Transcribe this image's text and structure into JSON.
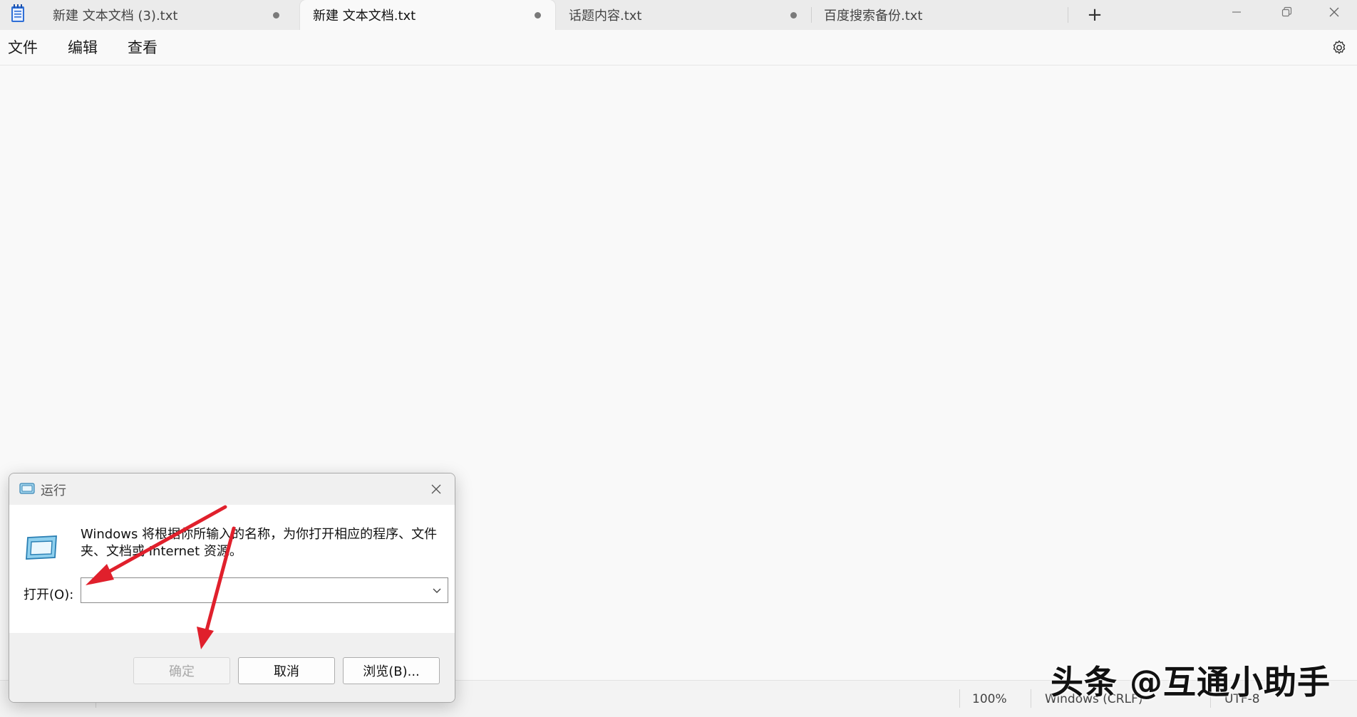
{
  "tabs": [
    {
      "label": "新建 文本文档 (3).txt",
      "modified": true,
      "active": false
    },
    {
      "label": "新建 文本文档.txt",
      "modified": true,
      "active": true
    },
    {
      "label": "话题内容.txt",
      "modified": true,
      "active": false
    },
    {
      "label": "百度搜索备份.txt",
      "modified": false,
      "active": false
    }
  ],
  "new_tab_label": "+",
  "menu": {
    "file": "文件",
    "edit": "编辑",
    "view": "查看"
  },
  "statusbar": {
    "position": "",
    "chars": "",
    "zoom": "100%",
    "line_ending": "Windows (CRLF)",
    "encoding": "UTF-8"
  },
  "watermark": "头条 @互通小助手",
  "run_dialog": {
    "title": "运行",
    "description": "Windows 将根据你所输入的名称，为你打开相应的程序、文件夹、文档或 Internet 资源。",
    "open_label": "打开(O):",
    "open_value": "",
    "ok_label": "确定",
    "cancel_label": "取消",
    "browse_label": "浏览(B)..."
  },
  "colors": {
    "arrow": "#e0202c",
    "accent": "#0067c0"
  }
}
